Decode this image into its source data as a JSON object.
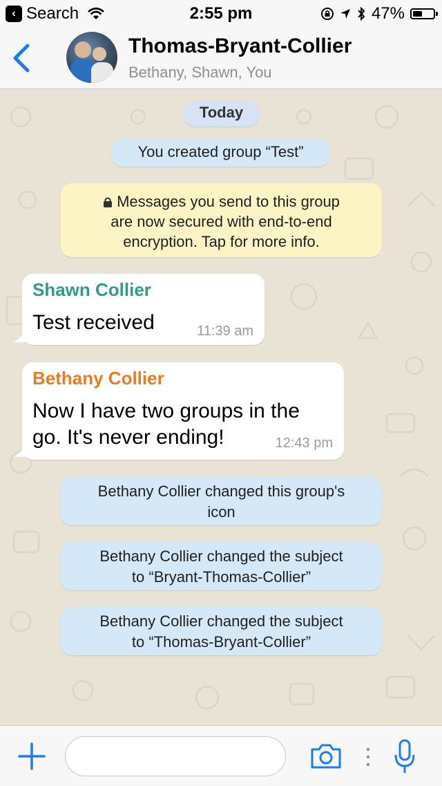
{
  "status_bar": {
    "back_app": "Search",
    "time": "2:55 pm",
    "battery_percent": "47%",
    "battery_level": 0.47
  },
  "header": {
    "title": "Thomas-Bryant-Collier",
    "subtitle": "Bethany, Shawn, You"
  },
  "chat": {
    "date_label": "Today",
    "created_notice": "You created group “Test”",
    "encryption_notice": [
      "Messages you send to this group",
      "are now secured with end-to-end",
      "encryption. Tap for more info."
    ],
    "messages": [
      {
        "sender": "Shawn Collier",
        "sender_color": "#2f9b8a",
        "lines": [
          "Test received"
        ],
        "time": "11:39 am"
      },
      {
        "sender": "Bethany Collier",
        "sender_color": "#e87d1e",
        "lines": [
          "Now I have two groups in the",
          "go. It's never ending!"
        ],
        "time": "12:43 pm"
      }
    ],
    "system_events": [
      [
        "Bethany Collier changed this group's",
        "icon"
      ],
      [
        "Bethany Collier changed the subject",
        "to “Bryant-Thomas-Collier”"
      ],
      [
        "Bethany Collier changed the subject",
        "to “Thomas-Bryant-Collier”"
      ]
    ]
  },
  "input_bar": {
    "placeholder": ""
  },
  "colors": {
    "accent": "#1a7cf5",
    "wallpaper": "#e9e3d6",
    "system_bubble": "#d5e8f7",
    "encryption_bubble": "#fdf4c5"
  }
}
